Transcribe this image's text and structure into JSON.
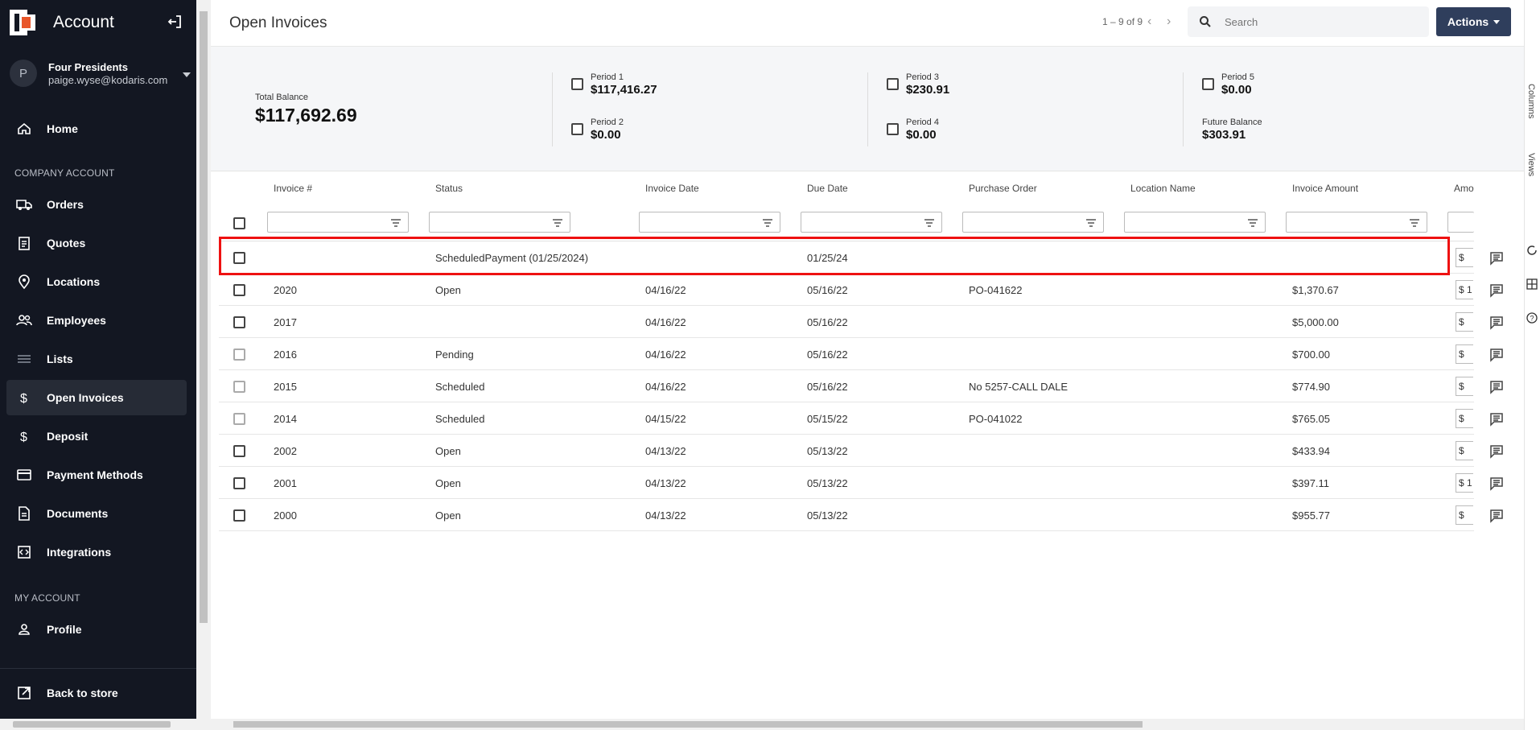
{
  "sidebar": {
    "title": "Account",
    "user": {
      "initial": "P",
      "name": "Four Presidents",
      "email": "paige.wyse@kodaris.com"
    },
    "nav": [
      {
        "label": "Home",
        "icon": "home-icon"
      }
    ],
    "company_section": "COMPANY ACCOUNT",
    "company_items": [
      {
        "label": "Orders",
        "icon": "truck-icon"
      },
      {
        "label": "Quotes",
        "icon": "clipboard-icon"
      },
      {
        "label": "Locations",
        "icon": "map-pin-icon"
      },
      {
        "label": "Employees",
        "icon": "people-icon"
      },
      {
        "label": "Lists",
        "icon": "list-icon"
      },
      {
        "label": "Open Invoices",
        "icon": "dollar-icon"
      },
      {
        "label": "Deposit",
        "icon": "dollar-icon"
      },
      {
        "label": "Payment Methods",
        "icon": "credit-card-icon"
      },
      {
        "label": "Documents",
        "icon": "document-icon"
      },
      {
        "label": "Integrations",
        "icon": "integration-icon"
      }
    ],
    "my_section": "MY ACCOUNT",
    "my_items": [
      {
        "label": "Profile",
        "icon": "person-icon"
      }
    ],
    "back_label": "Back to store"
  },
  "header": {
    "title": "Open Invoices",
    "pager": "1 – 9 of 9",
    "search_placeholder": "Search",
    "actions_label": "Actions"
  },
  "summary": {
    "total_label": "Total Balance",
    "total_value": "$117,692.69",
    "periods": [
      {
        "label": "Period 1",
        "value": "$117,416.27"
      },
      {
        "label": "Period 2",
        "value": "$0.00"
      },
      {
        "label": "Period 3",
        "value": "$230.91"
      },
      {
        "label": "Period 4",
        "value": "$0.00"
      },
      {
        "label": "Period 5",
        "value": "$0.00"
      }
    ],
    "future_label": "Future Balance",
    "future_value": "$303.91"
  },
  "table": {
    "columns": [
      "Invoice #",
      "Status",
      "Invoice Date",
      "Due Date",
      "Purchase Order",
      "Location Name",
      "Invoice Amount",
      "Amo"
    ],
    "rows": [
      {
        "invoice": "",
        "status": "ScheduledPayment (01/25/2024)",
        "invoice_date": "",
        "due_date": "01/25/24",
        "po": "",
        "location": "",
        "amount": "",
        "amt_input": "$"
      },
      {
        "invoice": "2020",
        "status": "Open",
        "invoice_date": "04/16/22",
        "due_date": "05/16/22",
        "po": "PO-041622",
        "location": "",
        "amount": "$1,370.67",
        "amt_input": "$ 1"
      },
      {
        "invoice": "2017",
        "status": "",
        "invoice_date": "04/16/22",
        "due_date": "05/16/22",
        "po": "",
        "location": "",
        "amount": "$5,000.00",
        "amt_input": "$"
      },
      {
        "invoice": "2016",
        "status": "Pending",
        "invoice_date": "04/16/22",
        "due_date": "05/16/22",
        "po": "",
        "location": "",
        "amount": "$700.00",
        "amt_input": "$"
      },
      {
        "invoice": "2015",
        "status": "Scheduled",
        "invoice_date": "04/16/22",
        "due_date": "05/16/22",
        "po": "No 5257-CALL DALE",
        "location": "",
        "amount": "$774.90",
        "amt_input": "$"
      },
      {
        "invoice": "2014",
        "status": "Scheduled",
        "invoice_date": "04/15/22",
        "due_date": "05/15/22",
        "po": "PO-041022",
        "location": "",
        "amount": "$765.05",
        "amt_input": "$"
      },
      {
        "invoice": "2002",
        "status": "Open",
        "invoice_date": "04/13/22",
        "due_date": "05/13/22",
        "po": "",
        "location": "",
        "amount": "$433.94",
        "amt_input": "$"
      },
      {
        "invoice": "2001",
        "status": "Open",
        "invoice_date": "04/13/22",
        "due_date": "05/13/22",
        "po": "",
        "location": "",
        "amount": "$397.11",
        "amt_input": "$ 1"
      },
      {
        "invoice": "2000",
        "status": "Open",
        "invoice_date": "04/13/22",
        "due_date": "05/13/22",
        "po": "",
        "location": "",
        "amount": "$955.77",
        "amt_input": "$"
      }
    ]
  },
  "rightbar": {
    "columns_tab": "Columns",
    "views_tab": "Views"
  },
  "colors": {
    "sidebar_bg": "#131722",
    "accent": "#2f3e5c",
    "highlight": "#e11111",
    "logo": "#e8562a"
  }
}
